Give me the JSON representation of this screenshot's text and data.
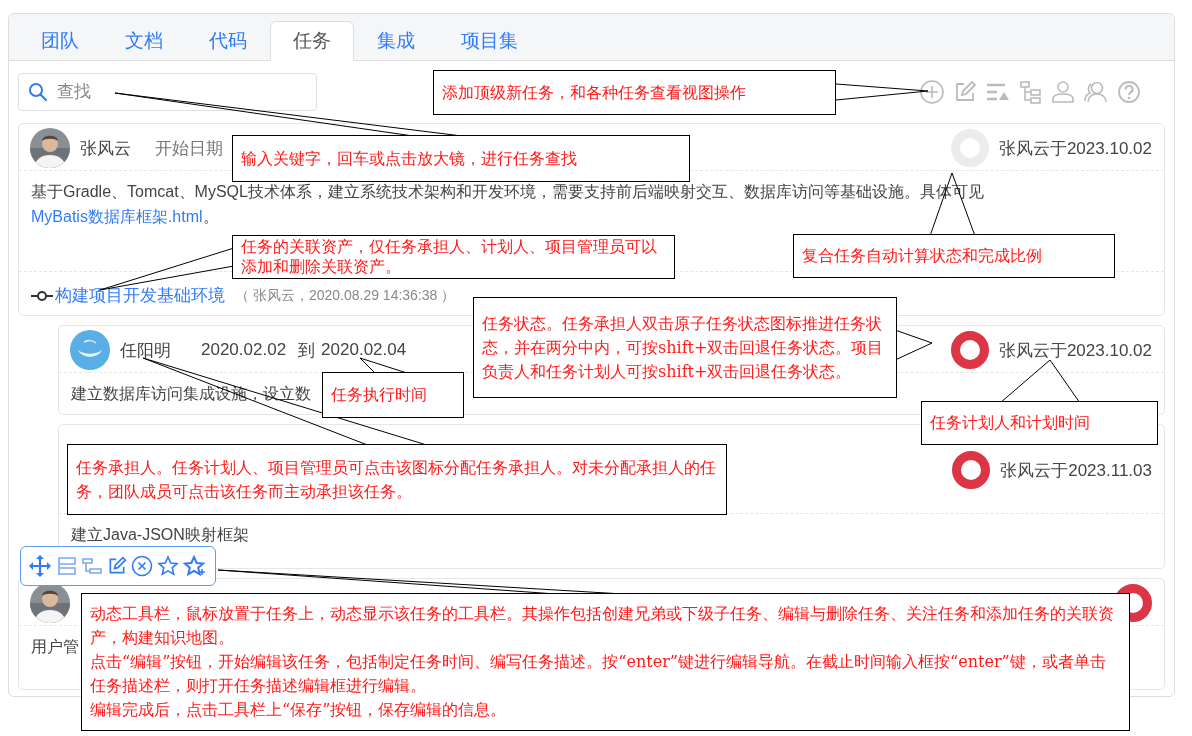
{
  "tabs": [
    {
      "label": "团队",
      "selected": false
    },
    {
      "label": "文档",
      "selected": false
    },
    {
      "label": "代码",
      "selected": false
    },
    {
      "label": "任务",
      "selected": true
    },
    {
      "label": "集成",
      "selected": false
    },
    {
      "label": "项目集",
      "selected": false
    }
  ],
  "search": {
    "placeholder": "查找"
  },
  "tasks": [
    {
      "indented": false,
      "assignee": "张风云",
      "start_label": "开始日期",
      "status": {
        "color": "#ececec"
      },
      "planner": "张风云于2023.10.02",
      "description": "基于Gradle、Tomcat、MySQL技术体系，建立系统技术架构和开发环境，需要支持前后端映射交互、数据库访问等基础设施。具体可见",
      "description_link": "MyBatis数据库框架.html",
      "description_end": "。",
      "asset": {
        "title": "构建项目开发基础环境",
        "meta": "（ 张风云，2020.08.29 14:36:38 ）"
      }
    },
    {
      "indented": true,
      "avatar": {
        "kind": "logo"
      },
      "assignee": "任阳明",
      "start": "2020.02.02",
      "to": "到",
      "end": "2020.02.04",
      "status": {
        "color": "#dc3545"
      },
      "planner": "张风云于2023.10.02",
      "description": "建立数据库访问集成设施，设立数"
    },
    {
      "indented": true,
      "status": {
        "color": "#dc3545"
      },
      "planner": "张风云于2023.11.03",
      "description": "建立Java-JSON映射框架"
    },
    {
      "indented": false,
      "status": {
        "color": "#dc3545"
      },
      "description": "用户管"
    }
  ],
  "callouts": [
    {
      "paragraphs": [
        "添加顶级新任务，和各种任务查看视图操作"
      ]
    },
    {
      "paragraphs": [
        "输入关键字，回车或点击放大镜，进行任务查找"
      ]
    },
    {
      "paragraphs": [
        "任务的关联资产，仅任务承担人、计划人、项目管理员可以添加和删除关联资产。"
      ]
    },
    {
      "paragraphs": [
        "复合任务自动计算状态和完成比例"
      ]
    },
    {
      "paragraphs": [
        "任务状态。任务承担人双击原子任务状态图标推进任务状态，并在两分中内，可按shift+双击回退任务状态。项目负责人和任务计划人可按shift+双击回退任务状态。"
      ]
    },
    {
      "paragraphs": [
        "任务执行时间"
      ]
    },
    {
      "paragraphs": [
        "任务计划人和计划时间"
      ]
    },
    {
      "paragraphs": [
        "任务承担人。任务计划人、项目管理员可点击该图标分配任务承担人。对未分配承担人的任务，团队成员可点击该任务而主动承担该任务。"
      ]
    },
    {
      "paragraphs": [
        "动态工具栏，鼠标放置于任务上，动态显示该任务的工具栏。其操作包括创建兄弟或下级子任务、编辑与删除任务、关注任务和添加任务的关联资产，构建知识地图。",
        "点击“编辑”按钮，开始编辑该任务，包括制定任务时间、编写任务描述。按“enter”键进行编辑导航。在截止时间输入框按“enter”键，或者单击任务描述栏，则打开任务描述编辑框进行编辑。",
        "编辑完成后，点击工具栏上“保存”按钮，保存编辑的信息。"
      ]
    }
  ]
}
